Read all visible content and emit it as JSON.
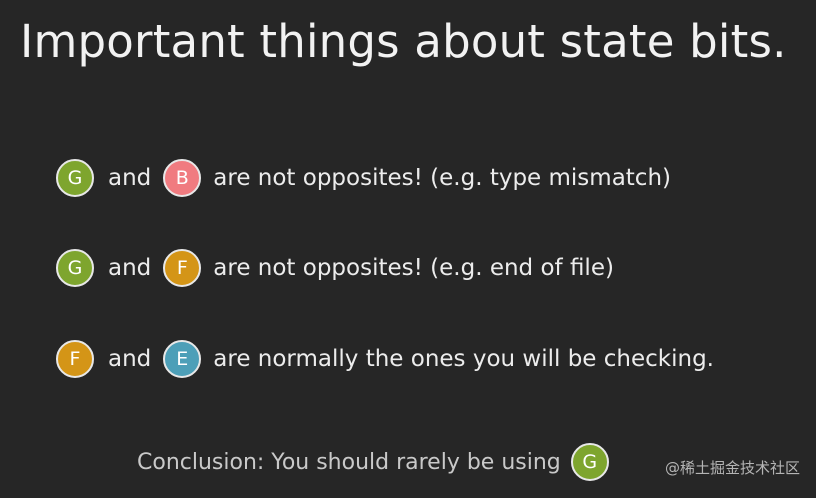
{
  "slide": {
    "title": "Important things about state bits.",
    "rows": [
      {
        "left_badge": {
          "letter": "G",
          "color": "#7ea52e"
        },
        "connector": "and",
        "right_badge": {
          "letter": "B",
          "color": "#f07b80"
        },
        "text": "are not opposites! (e.g. type mismatch)"
      },
      {
        "left_badge": {
          "letter": "G",
          "color": "#7ea52e"
        },
        "connector": "and",
        "right_badge": {
          "letter": "F",
          "color": "#d49517"
        },
        "text": "are not opposites! (e.g. end of file)"
      },
      {
        "left_badge": {
          "letter": "F",
          "color": "#d49517"
        },
        "connector": "and",
        "right_badge": {
          "letter": "E",
          "color": "#4d9fb8"
        },
        "text": "are normally the ones you will be checking."
      }
    ],
    "conclusion": {
      "text": "Conclusion: You should rarely be using",
      "badge": {
        "letter": "G",
        "color": "#7ea52e"
      }
    },
    "watermark": "@稀土掘金技术社区"
  }
}
